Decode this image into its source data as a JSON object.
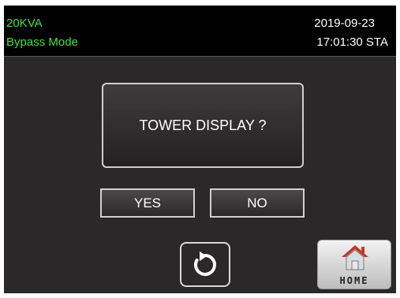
{
  "status": {
    "model": "20KVA",
    "mode": "Bypass Mode",
    "date": "2019-09-23",
    "time": "17:01:30 STA"
  },
  "dialog": {
    "question": "TOWER DISPLAY ?",
    "yes_label": "YES",
    "no_label": "NO"
  },
  "nav": {
    "back_icon": "rotate-back-icon",
    "home_icon": "house-icon",
    "home_label": "HOME"
  },
  "colors": {
    "status_text": "#3fe23a",
    "background": "#2a2828",
    "roof": "#c0392b"
  }
}
